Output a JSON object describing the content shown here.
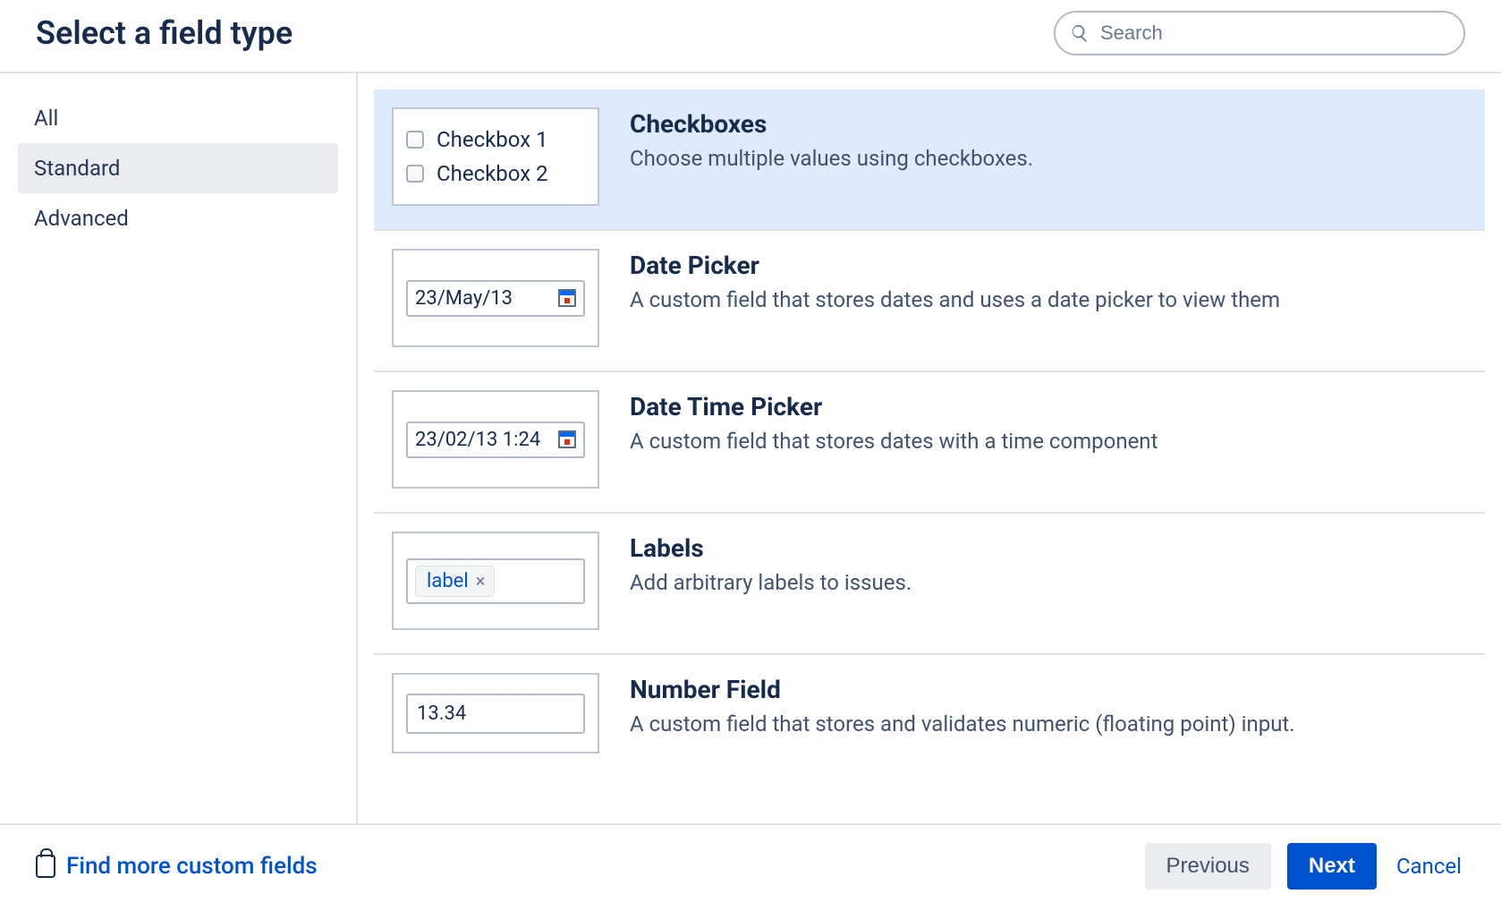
{
  "header": {
    "title": "Select a field type",
    "search_placeholder": "Search"
  },
  "sidebar": {
    "items": [
      {
        "label": "All",
        "selected": false
      },
      {
        "label": "Standard",
        "selected": true
      },
      {
        "label": "Advanced",
        "selected": false
      }
    ]
  },
  "fieldTypes": [
    {
      "id": "checkboxes",
      "title": "Checkboxes",
      "desc": "Choose multiple values using checkboxes.",
      "selected": true,
      "preview": {
        "kind": "checkboxes",
        "items": [
          "Checkbox 1",
          "Checkbox 2"
        ]
      }
    },
    {
      "id": "date-picker",
      "title": "Date Picker",
      "desc": "A custom field that stores dates and uses a date picker to view them",
      "selected": false,
      "preview": {
        "kind": "date",
        "value": "23/May/13"
      }
    },
    {
      "id": "date-time-picker",
      "title": "Date Time Picker",
      "desc": "A custom field that stores dates with a time component",
      "selected": false,
      "preview": {
        "kind": "datetime",
        "value": "23/02/13 1:24"
      }
    },
    {
      "id": "labels",
      "title": "Labels",
      "desc": "Add arbitrary labels to issues.",
      "selected": false,
      "preview": {
        "kind": "labels",
        "tag": "label"
      }
    },
    {
      "id": "number",
      "title": "Number Field",
      "desc": "A custom field that stores and validates numeric (floating point) input.",
      "selected": false,
      "preview": {
        "kind": "number",
        "value": "13.34"
      }
    }
  ],
  "footer": {
    "find_more": "Find more custom fields",
    "previous": "Previous",
    "next": "Next",
    "cancel": "Cancel"
  }
}
